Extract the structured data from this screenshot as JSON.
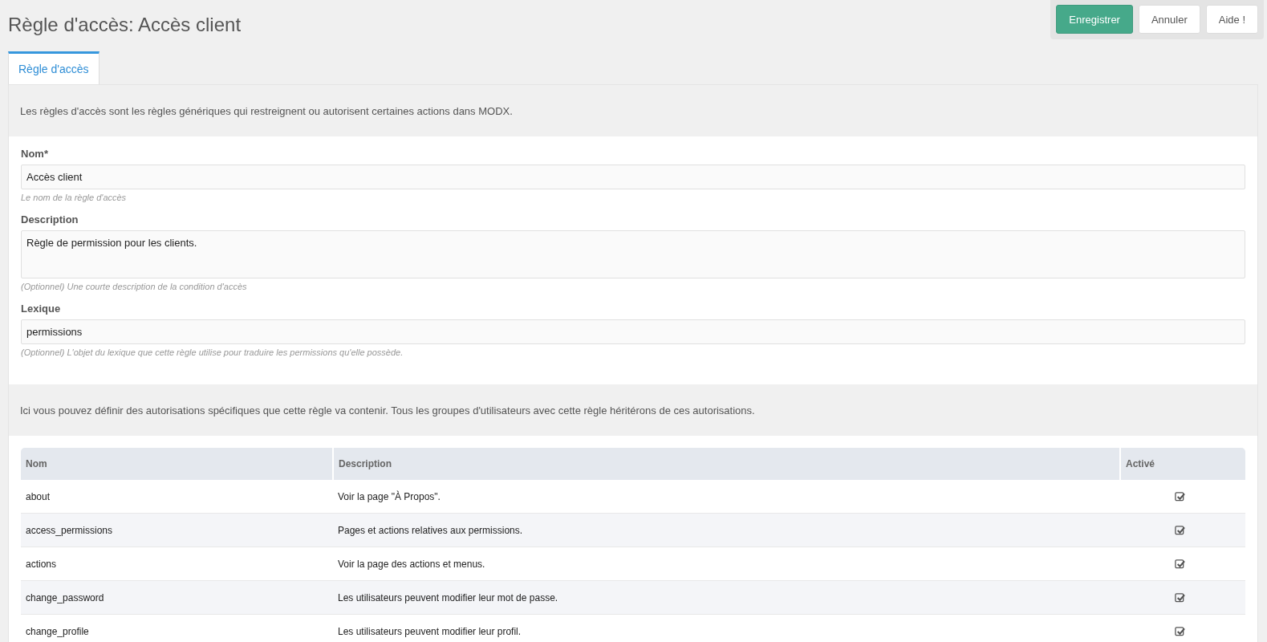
{
  "page": {
    "title": "Règle d'accès: Accès client"
  },
  "actions": [
    {
      "label": "Enregistrer",
      "kind": "primary"
    },
    {
      "label": "Annuler",
      "kind": "default"
    },
    {
      "label": "Aide !",
      "kind": "default"
    }
  ],
  "tabs": [
    {
      "label": "Règle d'accès",
      "selected": true
    }
  ],
  "intro": "Les règles d'accès sont les règles génériques qui restreignent ou autorisent certaines actions dans MODX.",
  "fields": [
    {
      "label": "Nom*",
      "value": "Accès client",
      "hint": "Le nom de la règle d'accès",
      "kind": "text"
    },
    {
      "label": "Description",
      "value": "Règle de permission pour les clients.",
      "hint": "(Optionnel) Une courte description de la condition d'accès",
      "kind": "textarea"
    },
    {
      "label": "Lexique",
      "value": "permissions",
      "hint": "(Optionnel) L'objet du lexique que cette règle utilise pour traduire les permissions qu'elle possède.",
      "kind": "text"
    }
  ],
  "permissions_intro": "Ici vous pouvez définir des autorisations spécifiques que cette règle va contenir. Tous les groupes d'utilisateurs avec cette règle héritérons de ces autorisations.",
  "table": {
    "columns": [
      "Nom",
      "Description",
      "Activé"
    ],
    "rows": [
      {
        "name": "about",
        "description": "Voir la page \"À Propos\".",
        "enabled": true
      },
      {
        "name": "access_permissions",
        "description": "Pages et actions relatives aux permissions.",
        "enabled": true
      },
      {
        "name": "actions",
        "description": "Voir la page des actions et menus.",
        "enabled": true
      },
      {
        "name": "change_password",
        "description": "Les utilisateurs peuvent modifier leur mot de passe.",
        "enabled": true
      },
      {
        "name": "change_profile",
        "description": "Les utilisateurs peuvent modifier leur profil.",
        "enabled": true
      }
    ]
  }
}
